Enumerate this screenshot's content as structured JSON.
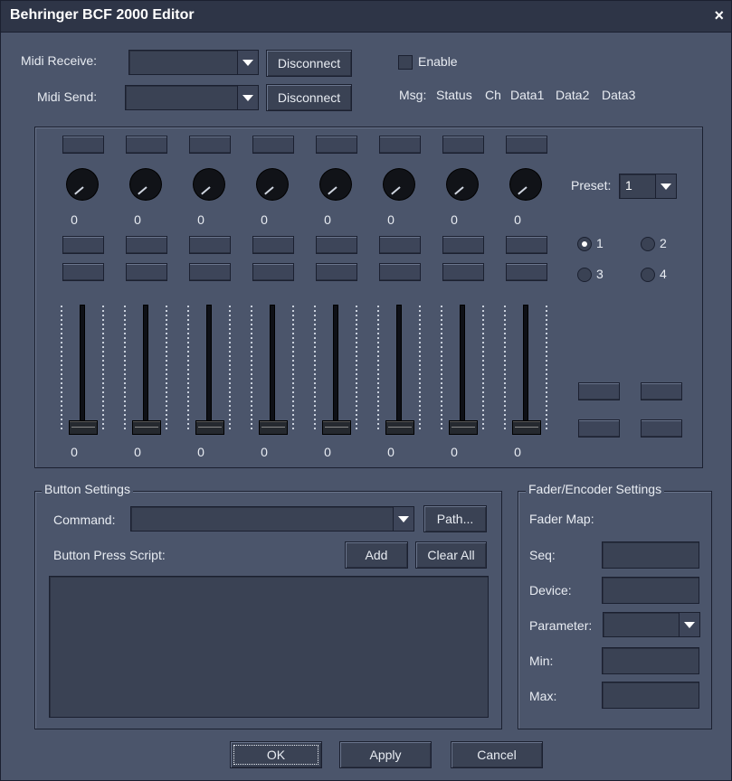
{
  "window": {
    "title": "Behringer BCF 2000 Editor",
    "close_glyph": "×"
  },
  "midi": {
    "receive_label": "Midi Receive:",
    "send_label": "Midi Send:",
    "receive_value": "",
    "send_value": "",
    "disconnect_receive": "Disconnect",
    "disconnect_send": "Disconnect",
    "enable_label": "Enable",
    "enable_checked": false,
    "msg_header": [
      "Msg:",
      "Status",
      "Ch",
      "Data1",
      "Data2",
      "Data3"
    ]
  },
  "channels": [
    {
      "encoder_value": "0",
      "fader_value": "0"
    },
    {
      "encoder_value": "0",
      "fader_value": "0"
    },
    {
      "encoder_value": "0",
      "fader_value": "0"
    },
    {
      "encoder_value": "0",
      "fader_value": "0"
    },
    {
      "encoder_value": "0",
      "fader_value": "0"
    },
    {
      "encoder_value": "0",
      "fader_value": "0"
    },
    {
      "encoder_value": "0",
      "fader_value": "0"
    },
    {
      "encoder_value": "0",
      "fader_value": "0"
    }
  ],
  "preset": {
    "label": "Preset:",
    "value": "1"
  },
  "layers": {
    "options": [
      "1",
      "2",
      "3",
      "4"
    ],
    "selected": "1"
  },
  "button_settings": {
    "title": "Button Settings",
    "command_label": "Command:",
    "command_value": "",
    "path_button": "Path...",
    "script_label": "Button Press Script:",
    "add_button": "Add",
    "clear_all_button": "Clear All",
    "script_text": ""
  },
  "fader_settings": {
    "title": "Fader/Encoder Settings",
    "fader_map_label": "Fader Map:",
    "seq_label": "Seq:",
    "device_label": "Device:",
    "parameter_label": "Parameter:",
    "min_label": "Min:",
    "max_label": "Max:",
    "seq_value": "",
    "device_value": "",
    "parameter_value": "",
    "min_value": "",
    "max_value": ""
  },
  "footer": {
    "ok": "OK",
    "apply": "Apply",
    "cancel": "Cancel"
  },
  "colors": {
    "background": "#4b556b",
    "titlebar": "#2e3547",
    "control": "#3a4254",
    "border": "#1b2030"
  }
}
